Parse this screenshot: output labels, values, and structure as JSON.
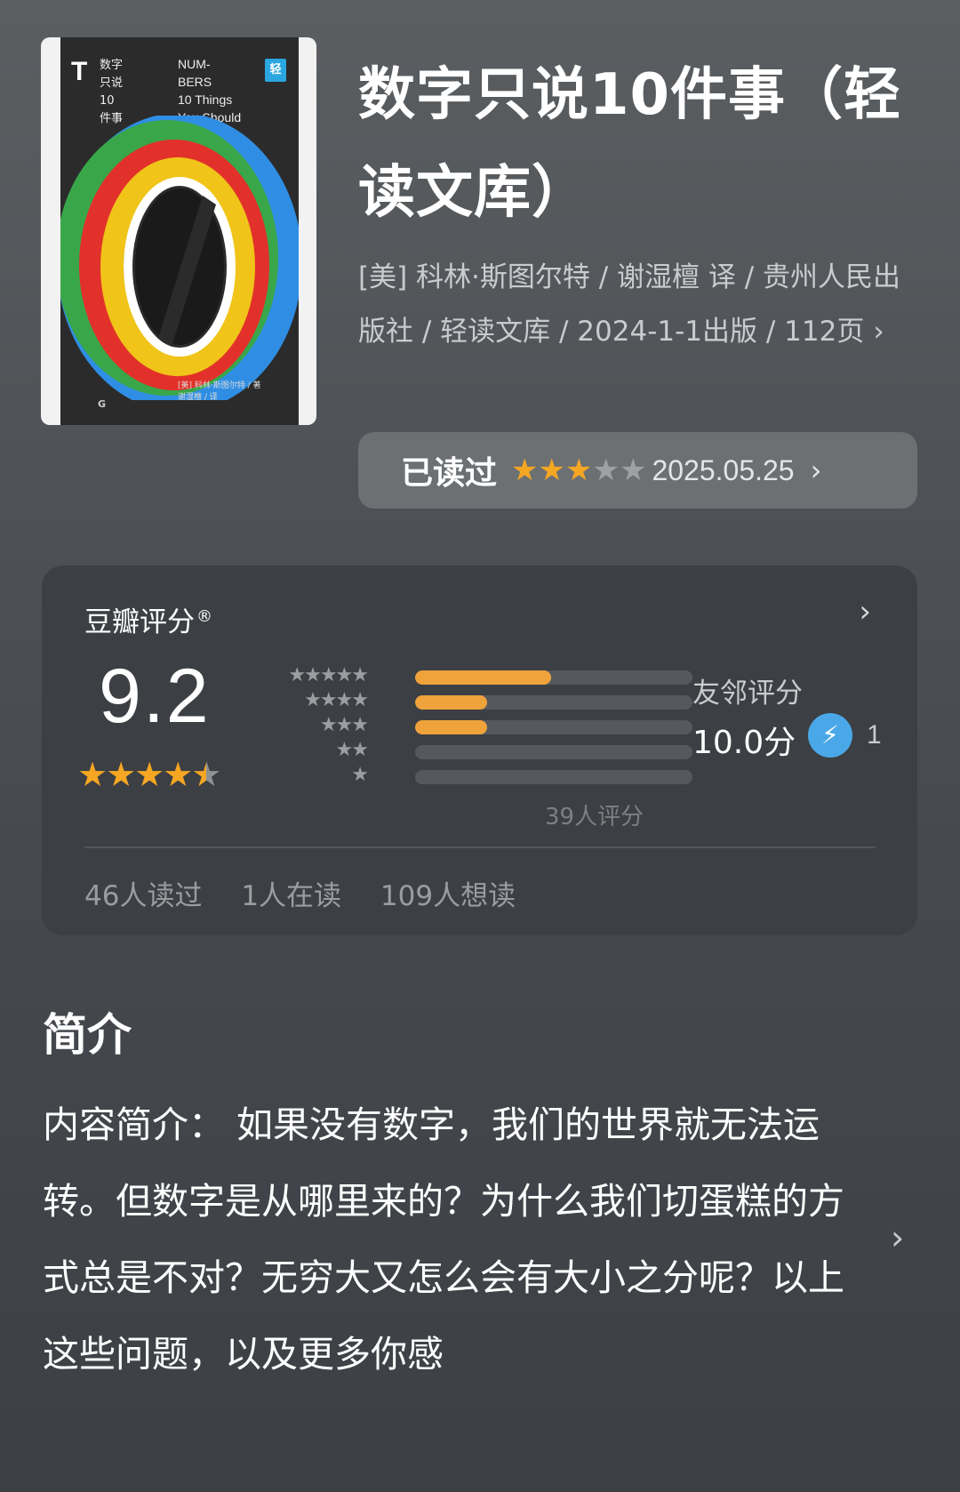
{
  "cover": {
    "t_mark": "T",
    "cn_title": "数字\n只说\n10\n件事",
    "en_title": "NUM-\nBERS\n10 Things\nYou Should\nKnow",
    "badge": "轻",
    "author": "[美] 科林·斯图尔特 / 著\n谢湿檀 / 译",
    "publisher_mark": "G",
    "colors": {
      "red": "#e2312a",
      "yellow": "#f0c419",
      "green": "#39a64a",
      "blue": "#2f8ee3",
      "dark": "#2b2b2b"
    }
  },
  "book": {
    "title": "数字只说10件事（轻读文库）",
    "meta": "[美] 科林·斯图尔特 / 谢湿檀 译 / 贵州人民出版社 / 轻读文库 / 2024-1-1出版 / 112页"
  },
  "read_status": {
    "label": "已读过",
    "my_rating": 3,
    "max_rating": 5,
    "date": "2025.05.25",
    "chevron_icon": "chevron-right-icon"
  },
  "rating": {
    "title": "豆瓣评分",
    "registered": "®",
    "score": "9.2",
    "stars": 4.5,
    "distribution": [
      {
        "stars": 5,
        "fraction": 0.49
      },
      {
        "stars": 4,
        "fraction": 0.26
      },
      {
        "stars": 3,
        "fraction": 0.26
      },
      {
        "stars": 2,
        "fraction": 0.0
      },
      {
        "stars": 1,
        "fraction": 0.0
      }
    ],
    "count_text": "39人评分",
    "friends_label": "友邻评分",
    "friends_score": "10.0分",
    "friends_count": "1",
    "stats": [
      "46人读过",
      "1人在读",
      "109人想读"
    ],
    "accent": "#f0a23b"
  },
  "intro": {
    "heading": "简介",
    "text": "内容简介： 如果没有数字，我们的世界就无法运转。但数字是从哪里来的？为什么我们切蛋糕的方式总是不对？无穷大又怎么会有大小之分呢？以上这些问题，以及更多你感"
  }
}
